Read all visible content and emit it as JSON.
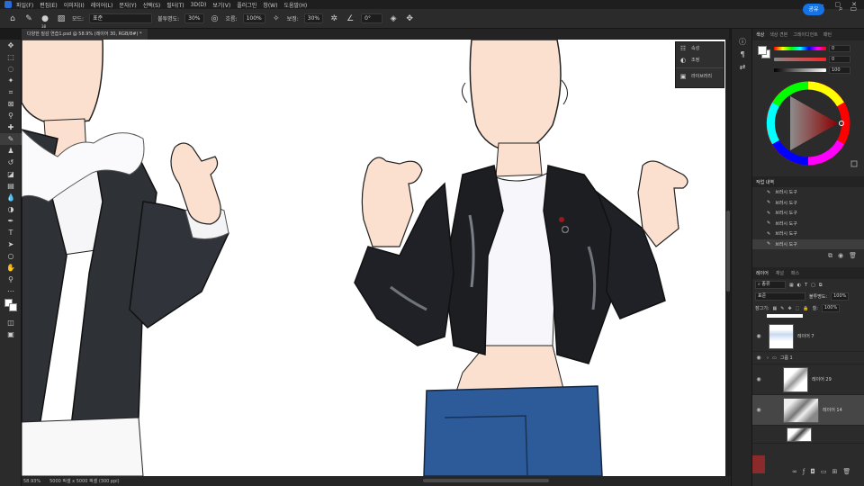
{
  "menu": [
    "파일(F)",
    "편집(E)",
    "이미지(I)",
    "레이어(L)",
    "문자(Y)",
    "선택(S)",
    "필터(T)",
    "3D(D)",
    "보기(V)",
    "플러그인",
    "창(W)",
    "도움말(H)"
  ],
  "options": {
    "brush_size": "38",
    "mode_label": "모드:",
    "mode_value": "표준",
    "opacity_label": "불투명도:",
    "opacity_value": "30%",
    "flow_label": "흐름:",
    "flow_value": "100%",
    "smoothing_label": "보정:",
    "smoothing_value": "30%",
    "angle_value": "0°",
    "share_label": "공유"
  },
  "document": {
    "tab_title": "다양한 질감 연습1.psd @ 58.9% (레이어 30, RGB/8#) *",
    "zoom": "58.93%",
    "doc_size": "5000 픽셀 x 5000 픽셀 (300 ppi)"
  },
  "popup": {
    "items": [
      "속성",
      "조정",
      "라이브러리"
    ]
  },
  "color_panel": {
    "tabs": [
      "색상",
      "색상 견본",
      "그레이디언트",
      "패턴"
    ],
    "r_value": "0",
    "g_value": "0",
    "b_value": "100"
  },
  "history": {
    "title": "작업 내역",
    "items": [
      "브러시 도구",
      "브러시 도구",
      "브러시 도구",
      "브러시 도구",
      "브러시 도구",
      "브러시 도구"
    ]
  },
  "layers_panel": {
    "tabs": [
      "레이어",
      "채널",
      "패스"
    ],
    "filter_label": "종류",
    "blend_mode": "표준",
    "opacity_label": "불투명도:",
    "opacity_value": "100%",
    "lock_label": "잠그기:",
    "fill_label": "칠:",
    "fill_value": "100%",
    "layers": [
      {
        "name": "레이어 7"
      },
      {
        "name": "그룹 1"
      },
      {
        "name": "레이어 29"
      },
      {
        "name": "레이어 14"
      }
    ]
  },
  "colors": {
    "jacket": "#1c1e22",
    "skin": "#fbe0cf",
    "jeans": "#2d5b9a",
    "accent": "#1473e6"
  }
}
